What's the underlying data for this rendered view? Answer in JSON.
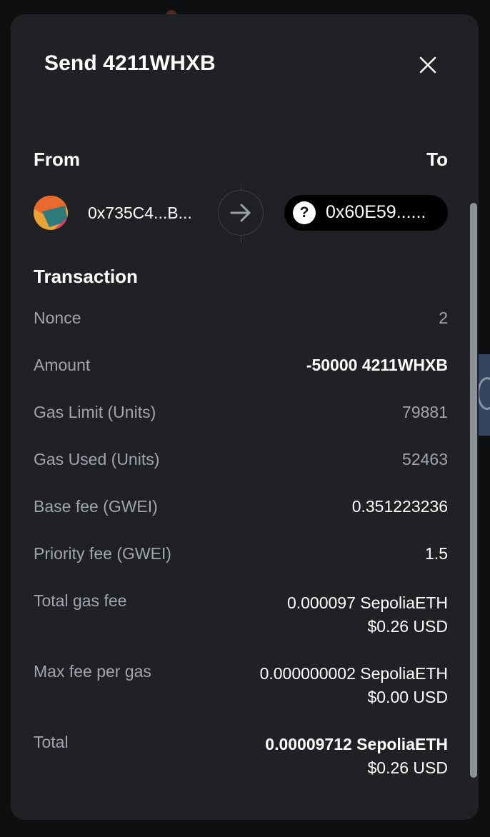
{
  "modal": {
    "title": "Send 4211WHXB",
    "close_icon": "close-icon"
  },
  "parties": {
    "from_label": "From",
    "to_label": "To",
    "from_address": "0x735C4...B...",
    "to_address": "0x60E59......",
    "to_badge": "?",
    "avatar_icon": "account-jazzicon",
    "arrow_icon": "arrow-right-icon"
  },
  "transaction": {
    "heading": "Transaction",
    "rows": [
      {
        "label": "Nonce",
        "value": "2"
      },
      {
        "label": "Amount",
        "value": "-50000 4211WHXB"
      },
      {
        "label": "Gas Limit (Units)",
        "value": "79881"
      },
      {
        "label": "Gas Used (Units)",
        "value": "52463"
      },
      {
        "label": "Base fee (GWEI)",
        "value": "0.351223236"
      },
      {
        "label": "Priority fee (GWEI)",
        "value": "1.5"
      },
      {
        "label": "Total gas fee",
        "value": "0.000097 SepoliaETH",
        "value2": "$0.26 USD"
      },
      {
        "label": "Max fee per gas",
        "value": "0.000000002 SepoliaETH",
        "value2": "$0.00 USD"
      },
      {
        "label": "Total",
        "value": "0.00009712 SepoliaETH",
        "value2": "$0.26 USD"
      }
    ]
  },
  "colors": {
    "modal_bg": "#1f2124",
    "page_bg": "#0e0f11",
    "label": "#a1a5ae",
    "text": "#ffffff"
  }
}
